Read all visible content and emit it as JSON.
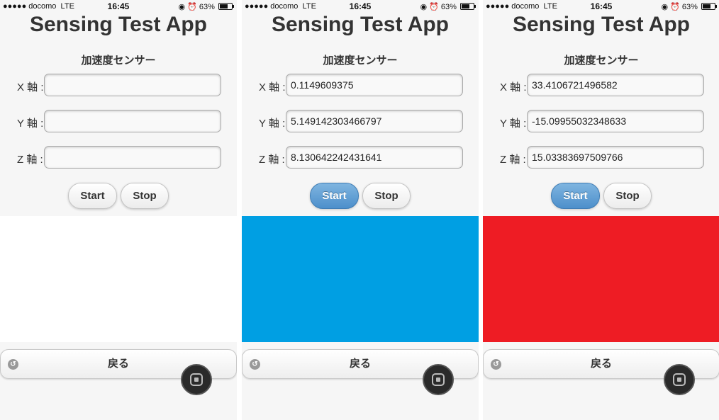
{
  "panels": [
    {
      "status": {
        "signal": "●●●●● docomo",
        "network": "LTE",
        "time": "16:45",
        "battery": "63%"
      },
      "title": "Sensing Test App",
      "section": "加速度センサー",
      "x_label": "X 軸 :",
      "y_label": "Y 軸 :",
      "z_label": "Z 軸 :",
      "x_value": "",
      "y_value": "",
      "z_value": "",
      "start_label": "Start",
      "stop_label": "Stop",
      "start_active": false,
      "color": "#ffffff",
      "back_label": "戻る"
    },
    {
      "status": {
        "signal": "●●●●● docomo",
        "network": "LTE",
        "time": "16:45",
        "battery": "63%"
      },
      "title": "Sensing Test App",
      "section": "加速度センサー",
      "x_label": "X 軸 :",
      "y_label": "Y 軸 :",
      "z_label": "Z 軸 :",
      "x_value": "0.1149609375",
      "y_value": "5.149142303466797",
      "z_value": "8.130642242431641",
      "start_label": "Start",
      "stop_label": "Stop",
      "start_active": true,
      "color": "#009fe3",
      "back_label": "戻る"
    },
    {
      "status": {
        "signal": "●●●●● docomo",
        "network": "LTE",
        "time": "16:45",
        "battery": "63%"
      },
      "title": "Sensing Test App",
      "section": "加速度センサー",
      "x_label": "X 軸 :",
      "y_label": "Y 軸 :",
      "z_label": "Z 軸 :",
      "x_value": "33.4106721496582",
      "y_value": "-15.09955032348633",
      "z_value": "15.03383697509766",
      "start_label": "Start",
      "stop_label": "Stop",
      "start_active": true,
      "color": "#ee1c24",
      "back_label": "戻る"
    }
  ],
  "icons": {
    "back": "back-arrow-icon",
    "home": "assistive-touch-icon",
    "alarm": "alarm-icon",
    "lock": "rotation-lock-icon"
  }
}
